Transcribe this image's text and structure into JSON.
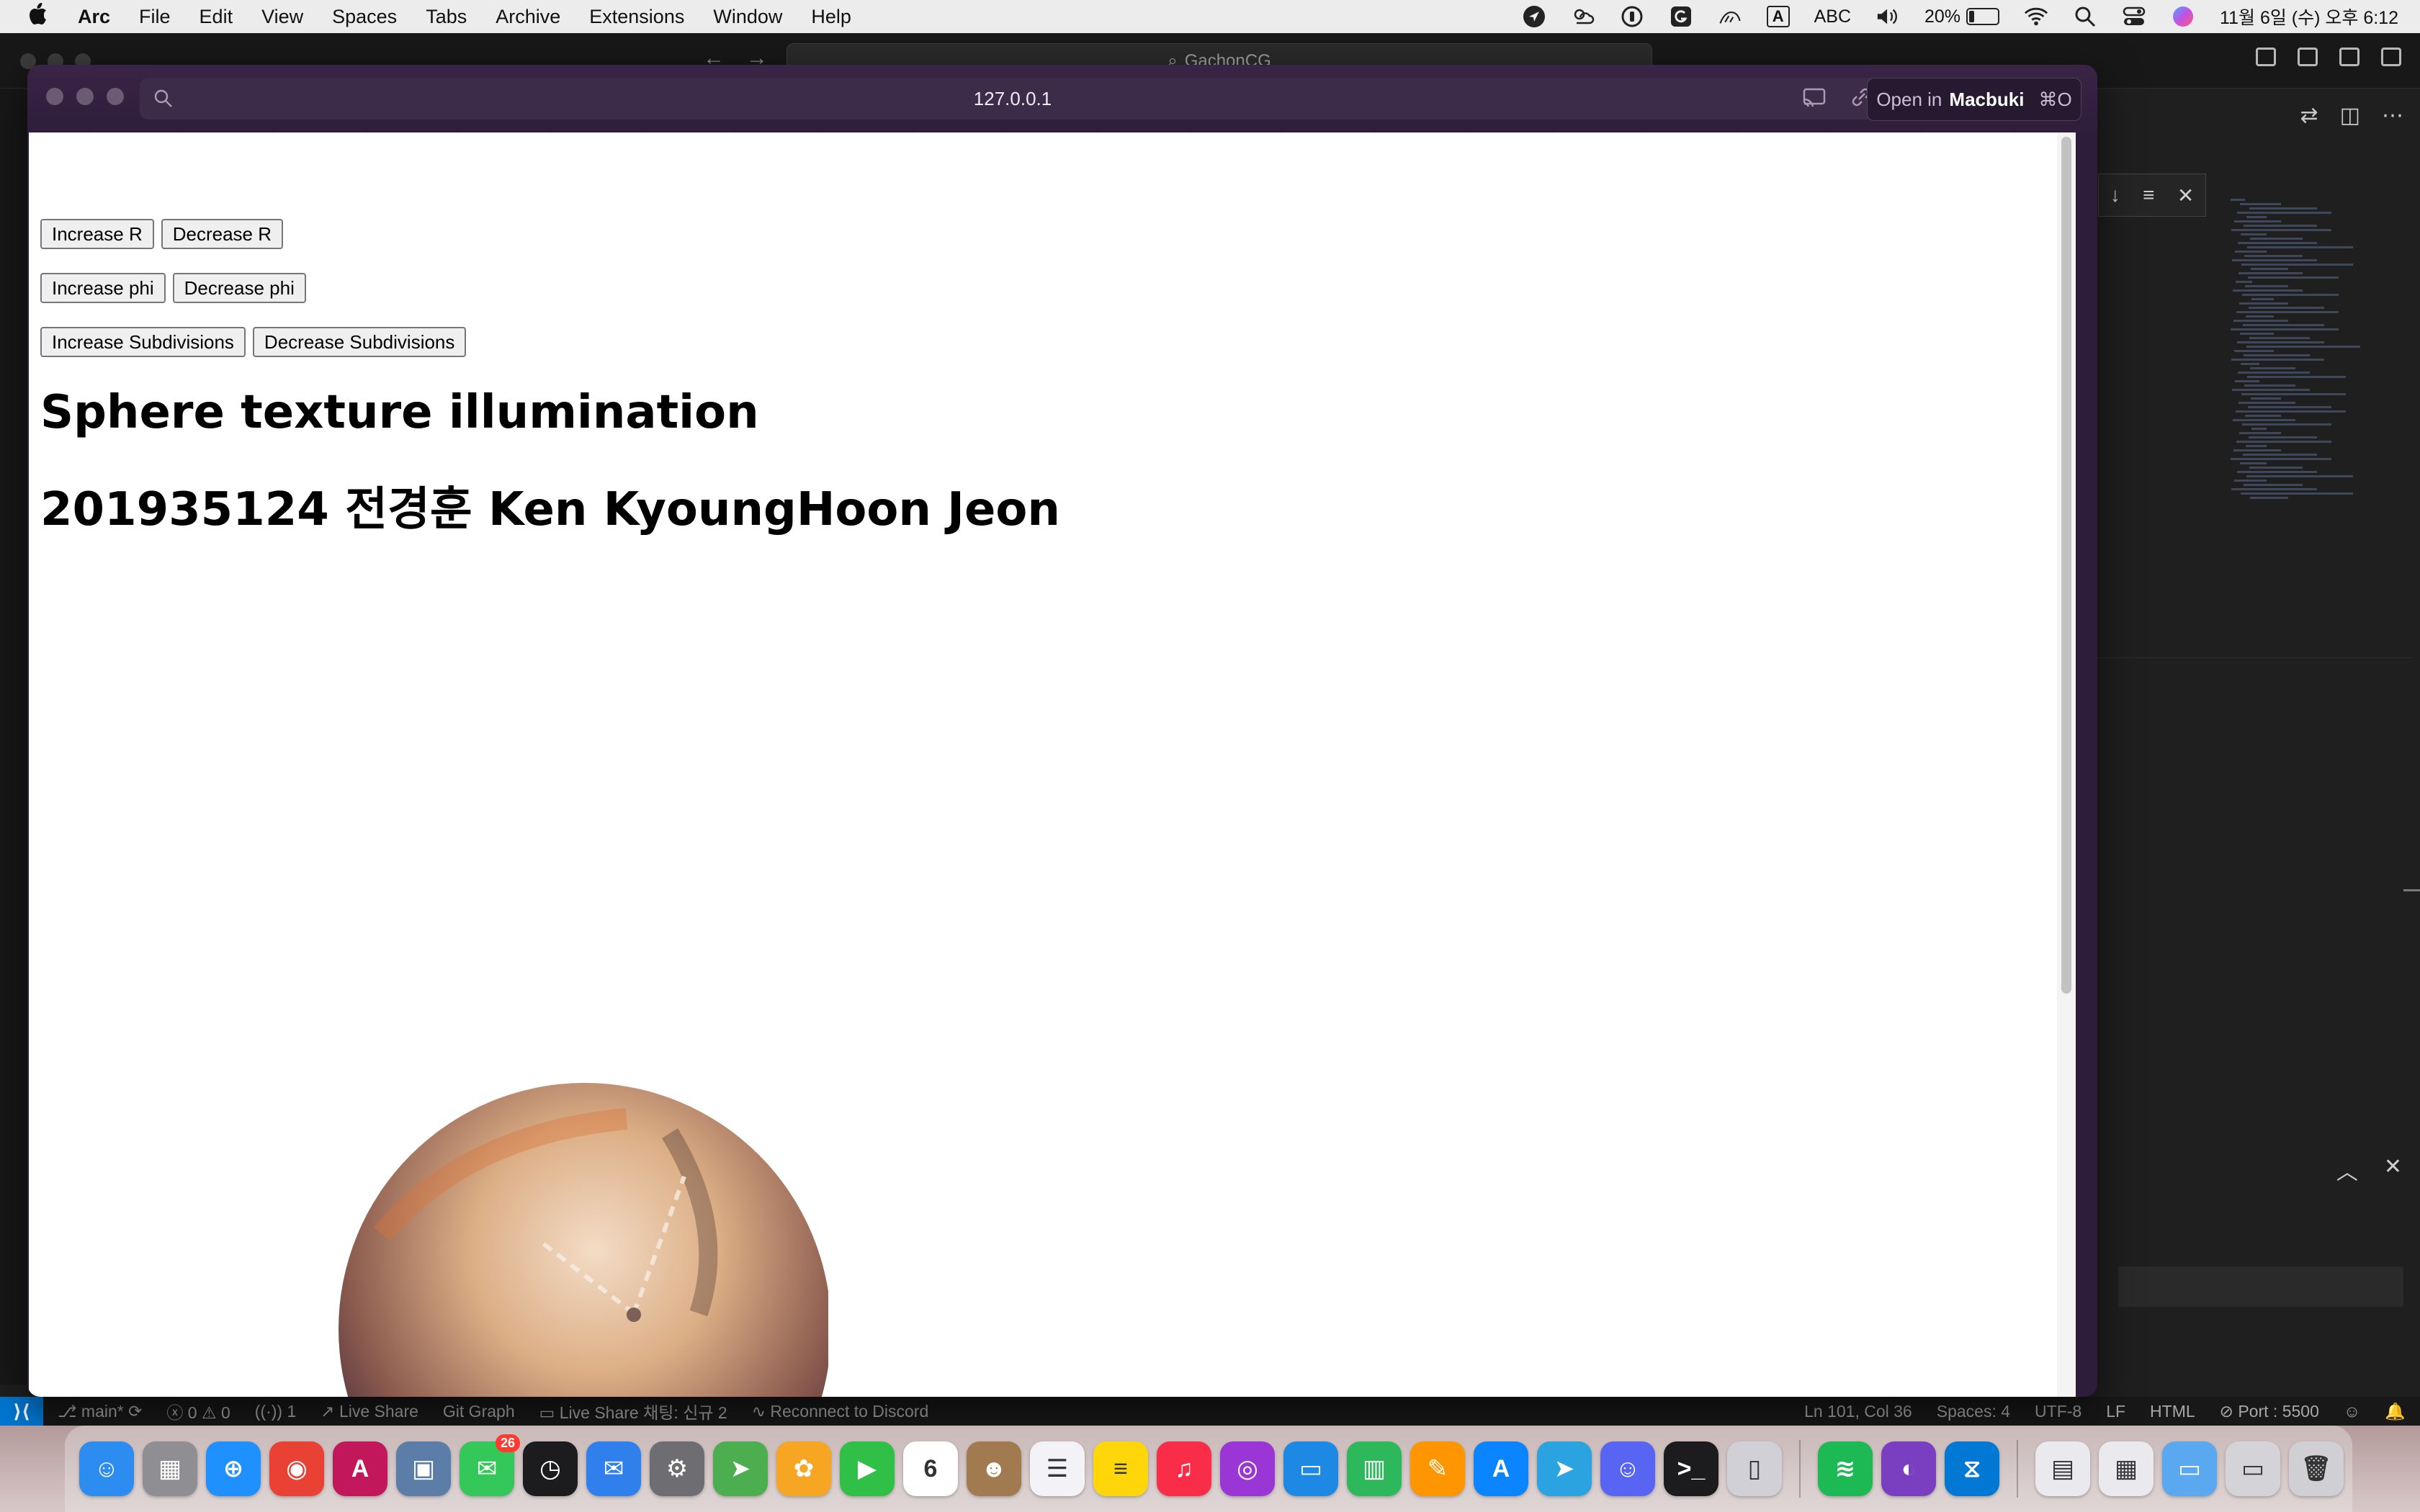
{
  "menubar": {
    "apple": "",
    "app_name": "Arc",
    "menus": [
      "File",
      "Edit",
      "View",
      "Spaces",
      "Tabs",
      "Archive",
      "Extensions",
      "Window",
      "Help"
    ],
    "input_badge": "A",
    "input_source": "ABC",
    "battery_percent": "20%",
    "battery_level": 0.2,
    "clock": "11월 6일 (수) 오후 6:12"
  },
  "vscode": {
    "search_text": "GachonCG",
    "status": {
      "branch": "main*",
      "errors": "0",
      "warnings": "0",
      "ports_forwarded": "1",
      "live_share": "Live Share",
      "git_graph": "Git Graph",
      "live_share_chat": "Live Share 채팅: 신규 2",
      "discord": "Reconnect to Discord",
      "cursor": "Ln 101, Col 36",
      "spaces": "Spaces: 4",
      "encoding": "UTF-8",
      "eol": "LF",
      "language": "HTML",
      "port": "Port : 5500"
    }
  },
  "arc": {
    "url": "127.0.0.1",
    "open_in_prefix": "Open in",
    "open_in_app": "Macbuki",
    "open_in_shortcut": "⌘O"
  },
  "page": {
    "buttons_r": [
      "Increase R",
      "Decrease R"
    ],
    "buttons_phi": [
      "Increase phi",
      "Decrease phi"
    ],
    "buttons_subdiv": [
      "Increase Subdivisions",
      "Decrease Subdivisions"
    ],
    "title": "Sphere texture illumination",
    "author": "201935124 전경훈 Ken KyoungHoon Jeon"
  },
  "dock": {
    "apps": [
      {
        "name": "Finder",
        "color": "#2d8cf0",
        "glyph": "☺"
      },
      {
        "name": "Launchpad",
        "color": "#8e8e93",
        "glyph": "▦"
      },
      {
        "name": "Safari",
        "color": "#1e90ff",
        "glyph": "⊕"
      },
      {
        "name": "Chrome",
        "color": "#e94235",
        "glyph": "◉"
      },
      {
        "name": "Affinity",
        "color": "#c2185b",
        "glyph": "A"
      },
      {
        "name": "Preview",
        "color": "#5b7da8",
        "glyph": "▣"
      },
      {
        "name": "Messages",
        "color": "#34c759",
        "glyph": "✉",
        "badge": "26"
      },
      {
        "name": "Clock",
        "color": "#1c1c1e",
        "glyph": "◷"
      },
      {
        "name": "Mail",
        "color": "#2f80ed",
        "glyph": "✉"
      },
      {
        "name": "System Settings",
        "color": "#6d6d72",
        "glyph": "⚙"
      },
      {
        "name": "Maps",
        "color": "#4cae4f",
        "glyph": "➤"
      },
      {
        "name": "Photos",
        "color": "#f6a623",
        "glyph": "✿"
      },
      {
        "name": "FaceTime",
        "color": "#30c048",
        "glyph": "▶"
      },
      {
        "name": "Calendar",
        "color": "#ffffff",
        "glyph": "6"
      },
      {
        "name": "Contacts",
        "color": "#a17a4f",
        "glyph": "☻"
      },
      {
        "name": "Reminders",
        "color": "#f2f2f7",
        "glyph": "☰"
      },
      {
        "name": "Notes",
        "color": "#ffd60a",
        "glyph": "≡"
      },
      {
        "name": "Music",
        "color": "#fa2d48",
        "glyph": "♫"
      },
      {
        "name": "Podcasts",
        "color": "#9b36d6",
        "glyph": "◎"
      },
      {
        "name": "Keynote",
        "color": "#1e88e5",
        "glyph": "▭"
      },
      {
        "name": "Numbers",
        "color": "#2eb85c",
        "glyph": "▥"
      },
      {
        "name": "Pages",
        "color": "#ff9500",
        "glyph": "✎"
      },
      {
        "name": "App Store",
        "color": "#0a84ff",
        "glyph": "A"
      },
      {
        "name": "Telegram",
        "color": "#2aa3e0",
        "glyph": "➤"
      },
      {
        "name": "Discord",
        "color": "#5865f2",
        "glyph": "☺"
      },
      {
        "name": "Terminal",
        "color": "#1c1c1e",
        "glyph": ">_"
      },
      {
        "name": "iPhone Mirroring",
        "color": "#d0d0d6",
        "glyph": "▯"
      },
      {
        "name": "Spotify",
        "color": "#1db954",
        "glyph": "≋"
      },
      {
        "name": "GitHub Desktop",
        "color": "#7a3fc0",
        "glyph": "◐"
      },
      {
        "name": "VS Code",
        "color": "#0078d4",
        "glyph": "⧖"
      },
      {
        "name": "Documents",
        "color": "#e9e9ee",
        "glyph": "▤"
      },
      {
        "name": "Downloads",
        "color": "#e9e9ee",
        "glyph": "▦"
      },
      {
        "name": "Folder",
        "color": "#5aa9f0",
        "glyph": "▭"
      },
      {
        "name": "Car",
        "color": "#d4d4d8",
        "glyph": "▭"
      },
      {
        "name": "Trash",
        "color": "#cfcfd4",
        "glyph": "🗑"
      }
    ]
  }
}
